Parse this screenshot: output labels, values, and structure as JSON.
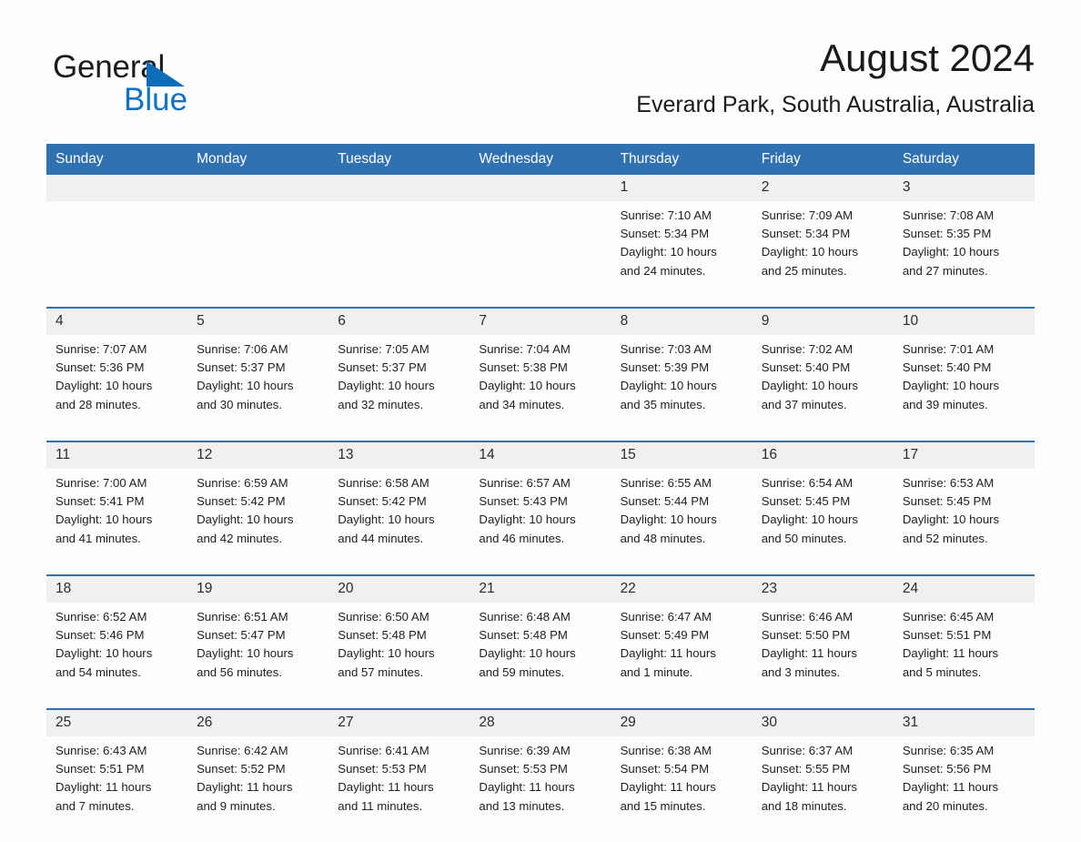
{
  "brand": {
    "name_part1": "General",
    "name_part2": "Blue",
    "triangle_color": "#0f6cb6",
    "blue_color": "#0f72c4"
  },
  "header": {
    "title": "August 2024",
    "location": "Everard Park, South Australia, Australia"
  },
  "theme": {
    "header_blue": "#3071b2",
    "date_band": "#f0f0f0",
    "page_bg": "#fdfdfd"
  },
  "weekday_headers": [
    "Sunday",
    "Monday",
    "Tuesday",
    "Wednesday",
    "Thursday",
    "Friday",
    "Saturday"
  ],
  "weeks": [
    {
      "dates": [
        "",
        "",
        "",
        "",
        "1",
        "2",
        "3"
      ],
      "cells": [
        {
          "sunrise": "",
          "sunset": "",
          "daylight1": "",
          "daylight2": ""
        },
        {
          "sunrise": "",
          "sunset": "",
          "daylight1": "",
          "daylight2": ""
        },
        {
          "sunrise": "",
          "sunset": "",
          "daylight1": "",
          "daylight2": ""
        },
        {
          "sunrise": "",
          "sunset": "",
          "daylight1": "",
          "daylight2": ""
        },
        {
          "sunrise": "Sunrise: 7:10 AM",
          "sunset": "Sunset: 5:34 PM",
          "daylight1": "Daylight: 10 hours",
          "daylight2": "and 24 minutes."
        },
        {
          "sunrise": "Sunrise: 7:09 AM",
          "sunset": "Sunset: 5:34 PM",
          "daylight1": "Daylight: 10 hours",
          "daylight2": "and 25 minutes."
        },
        {
          "sunrise": "Sunrise: 7:08 AM",
          "sunset": "Sunset: 5:35 PM",
          "daylight1": "Daylight: 10 hours",
          "daylight2": "and 27 minutes."
        }
      ]
    },
    {
      "dates": [
        "4",
        "5",
        "6",
        "7",
        "8",
        "9",
        "10"
      ],
      "cells": [
        {
          "sunrise": "Sunrise: 7:07 AM",
          "sunset": "Sunset: 5:36 PM",
          "daylight1": "Daylight: 10 hours",
          "daylight2": "and 28 minutes."
        },
        {
          "sunrise": "Sunrise: 7:06 AM",
          "sunset": "Sunset: 5:37 PM",
          "daylight1": "Daylight: 10 hours",
          "daylight2": "and 30 minutes."
        },
        {
          "sunrise": "Sunrise: 7:05 AM",
          "sunset": "Sunset: 5:37 PM",
          "daylight1": "Daylight: 10 hours",
          "daylight2": "and 32 minutes."
        },
        {
          "sunrise": "Sunrise: 7:04 AM",
          "sunset": "Sunset: 5:38 PM",
          "daylight1": "Daylight: 10 hours",
          "daylight2": "and 34 minutes."
        },
        {
          "sunrise": "Sunrise: 7:03 AM",
          "sunset": "Sunset: 5:39 PM",
          "daylight1": "Daylight: 10 hours",
          "daylight2": "and 35 minutes."
        },
        {
          "sunrise": "Sunrise: 7:02 AM",
          "sunset": "Sunset: 5:40 PM",
          "daylight1": "Daylight: 10 hours",
          "daylight2": "and 37 minutes."
        },
        {
          "sunrise": "Sunrise: 7:01 AM",
          "sunset": "Sunset: 5:40 PM",
          "daylight1": "Daylight: 10 hours",
          "daylight2": "and 39 minutes."
        }
      ]
    },
    {
      "dates": [
        "11",
        "12",
        "13",
        "14",
        "15",
        "16",
        "17"
      ],
      "cells": [
        {
          "sunrise": "Sunrise: 7:00 AM",
          "sunset": "Sunset: 5:41 PM",
          "daylight1": "Daylight: 10 hours",
          "daylight2": "and 41 minutes."
        },
        {
          "sunrise": "Sunrise: 6:59 AM",
          "sunset": "Sunset: 5:42 PM",
          "daylight1": "Daylight: 10 hours",
          "daylight2": "and 42 minutes."
        },
        {
          "sunrise": "Sunrise: 6:58 AM",
          "sunset": "Sunset: 5:42 PM",
          "daylight1": "Daylight: 10 hours",
          "daylight2": "and 44 minutes."
        },
        {
          "sunrise": "Sunrise: 6:57 AM",
          "sunset": "Sunset: 5:43 PM",
          "daylight1": "Daylight: 10 hours",
          "daylight2": "and 46 minutes."
        },
        {
          "sunrise": "Sunrise: 6:55 AM",
          "sunset": "Sunset: 5:44 PM",
          "daylight1": "Daylight: 10 hours",
          "daylight2": "and 48 minutes."
        },
        {
          "sunrise": "Sunrise: 6:54 AM",
          "sunset": "Sunset: 5:45 PM",
          "daylight1": "Daylight: 10 hours",
          "daylight2": "and 50 minutes."
        },
        {
          "sunrise": "Sunrise: 6:53 AM",
          "sunset": "Sunset: 5:45 PM",
          "daylight1": "Daylight: 10 hours",
          "daylight2": "and 52 minutes."
        }
      ]
    },
    {
      "dates": [
        "18",
        "19",
        "20",
        "21",
        "22",
        "23",
        "24"
      ],
      "cells": [
        {
          "sunrise": "Sunrise: 6:52 AM",
          "sunset": "Sunset: 5:46 PM",
          "daylight1": "Daylight: 10 hours",
          "daylight2": "and 54 minutes."
        },
        {
          "sunrise": "Sunrise: 6:51 AM",
          "sunset": "Sunset: 5:47 PM",
          "daylight1": "Daylight: 10 hours",
          "daylight2": "and 56 minutes."
        },
        {
          "sunrise": "Sunrise: 6:50 AM",
          "sunset": "Sunset: 5:48 PM",
          "daylight1": "Daylight: 10 hours",
          "daylight2": "and 57 minutes."
        },
        {
          "sunrise": "Sunrise: 6:48 AM",
          "sunset": "Sunset: 5:48 PM",
          "daylight1": "Daylight: 10 hours",
          "daylight2": "and 59 minutes."
        },
        {
          "sunrise": "Sunrise: 6:47 AM",
          "sunset": "Sunset: 5:49 PM",
          "daylight1": "Daylight: 11 hours",
          "daylight2": "and 1 minute."
        },
        {
          "sunrise": "Sunrise: 6:46 AM",
          "sunset": "Sunset: 5:50 PM",
          "daylight1": "Daylight: 11 hours",
          "daylight2": "and 3 minutes."
        },
        {
          "sunrise": "Sunrise: 6:45 AM",
          "sunset": "Sunset: 5:51 PM",
          "daylight1": "Daylight: 11 hours",
          "daylight2": "and 5 minutes."
        }
      ]
    },
    {
      "dates": [
        "25",
        "26",
        "27",
        "28",
        "29",
        "30",
        "31"
      ],
      "cells": [
        {
          "sunrise": "Sunrise: 6:43 AM",
          "sunset": "Sunset: 5:51 PM",
          "daylight1": "Daylight: 11 hours",
          "daylight2": "and 7 minutes."
        },
        {
          "sunrise": "Sunrise: 6:42 AM",
          "sunset": "Sunset: 5:52 PM",
          "daylight1": "Daylight: 11 hours",
          "daylight2": "and 9 minutes."
        },
        {
          "sunrise": "Sunrise: 6:41 AM",
          "sunset": "Sunset: 5:53 PM",
          "daylight1": "Daylight: 11 hours",
          "daylight2": "and 11 minutes."
        },
        {
          "sunrise": "Sunrise: 6:39 AM",
          "sunset": "Sunset: 5:53 PM",
          "daylight1": "Daylight: 11 hours",
          "daylight2": "and 13 minutes."
        },
        {
          "sunrise": "Sunrise: 6:38 AM",
          "sunset": "Sunset: 5:54 PM",
          "daylight1": "Daylight: 11 hours",
          "daylight2": "and 15 minutes."
        },
        {
          "sunrise": "Sunrise: 6:37 AM",
          "sunset": "Sunset: 5:55 PM",
          "daylight1": "Daylight: 11 hours",
          "daylight2": "and 18 minutes."
        },
        {
          "sunrise": "Sunrise: 6:35 AM",
          "sunset": "Sunset: 5:56 PM",
          "daylight1": "Daylight: 11 hours",
          "daylight2": "and 20 minutes."
        }
      ]
    }
  ]
}
